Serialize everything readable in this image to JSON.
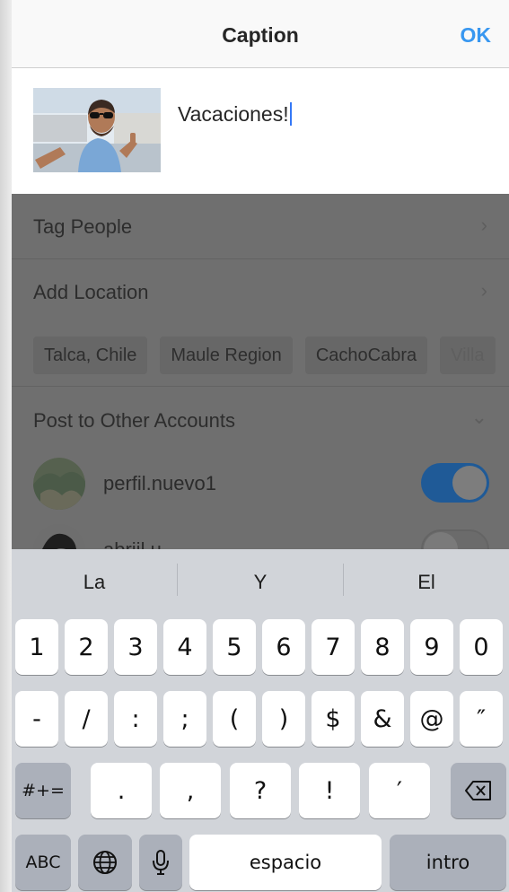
{
  "header": {
    "title": "Caption",
    "ok_label": "OK"
  },
  "caption": {
    "text": "Vacaciones!"
  },
  "rows": {
    "tag_people": "Tag People",
    "add_location": "Add Location",
    "post_other": "Post to Other Accounts"
  },
  "location_chips": [
    "Talca, Chile",
    "Maule Region",
    "CachoCabra",
    "Villa"
  ],
  "accounts": [
    {
      "name": "perfil.nuevo1",
      "enabled": true
    },
    {
      "name": "abriil.u",
      "enabled": false
    }
  ],
  "keyboard": {
    "suggestions": [
      "La",
      "Y",
      "El"
    ],
    "row1": [
      "1",
      "2",
      "3",
      "4",
      "5",
      "6",
      "7",
      "8",
      "9",
      "0"
    ],
    "row2": [
      "-",
      "/",
      ":",
      ";",
      "(",
      ")",
      "$",
      "&",
      "@",
      "″"
    ],
    "row3_left": "#+=",
    "row3": [
      ".",
      ",",
      "?",
      "!",
      "′"
    ],
    "abc": "ABC",
    "space": "espacio",
    "return": "intro"
  },
  "colors": {
    "accent": "#3897f0",
    "toggle_on": "#1f5a97"
  }
}
